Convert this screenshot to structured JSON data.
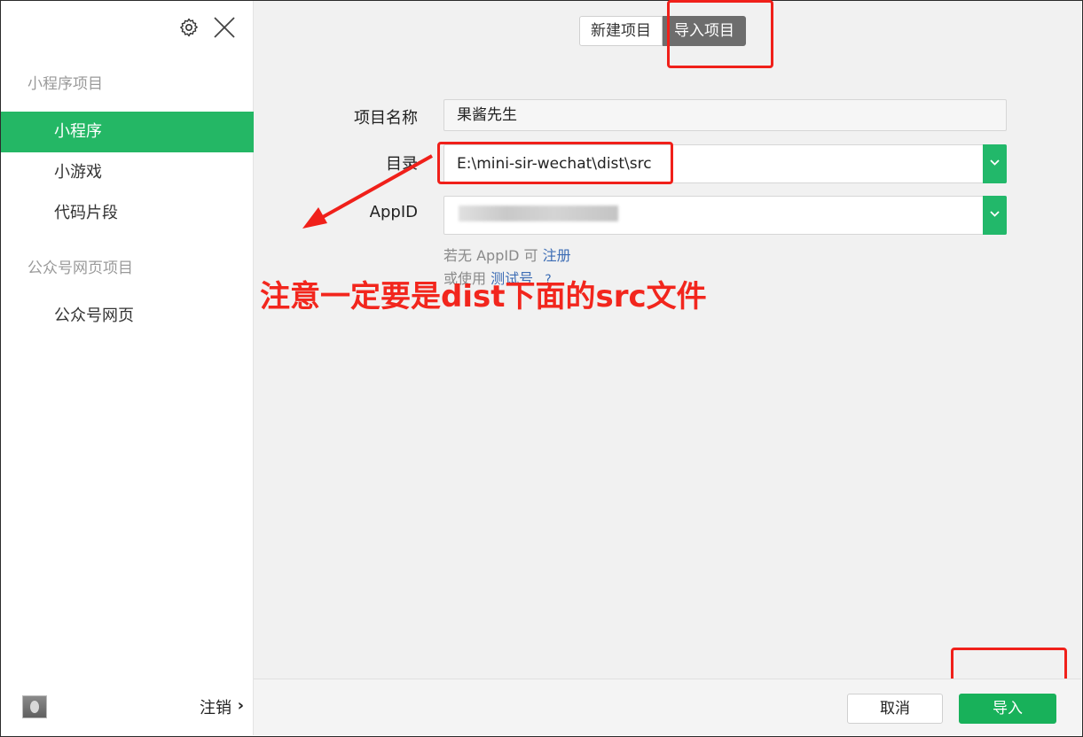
{
  "sidebar": {
    "section_miniprogram": "小程序项目",
    "items": [
      {
        "label": "小程序",
        "active": true
      },
      {
        "label": "小游戏",
        "active": false
      },
      {
        "label": "代码片段",
        "active": false
      }
    ],
    "section_official": "公众号网页项目",
    "official_items": [
      {
        "label": "公众号网页",
        "active": false
      }
    ],
    "logout_label": "注销",
    "logout_chevron": "›"
  },
  "tabs": {
    "new_label": "新建项目",
    "import_label": "导入项目"
  },
  "form": {
    "name_label": "项目名称",
    "name_value": "果酱先生",
    "dir_label": "目录",
    "dir_value": "E:\\mini-sir-wechat\\dist\\src",
    "appid_label": "AppID",
    "hint1_prefix": "若无 AppID 可",
    "hint1_link": "注册",
    "hint2_prefix": "或使用",
    "hint2_link": "测试号",
    "help": "?"
  },
  "annotation": {
    "text": "注意一定要是dist下面的src文件",
    "color": "#f2261d"
  },
  "footer": {
    "cancel_label": "取消",
    "import_label": "导入"
  },
  "colors": {
    "accent": "#24b765",
    "highlight": "#f0201a"
  }
}
